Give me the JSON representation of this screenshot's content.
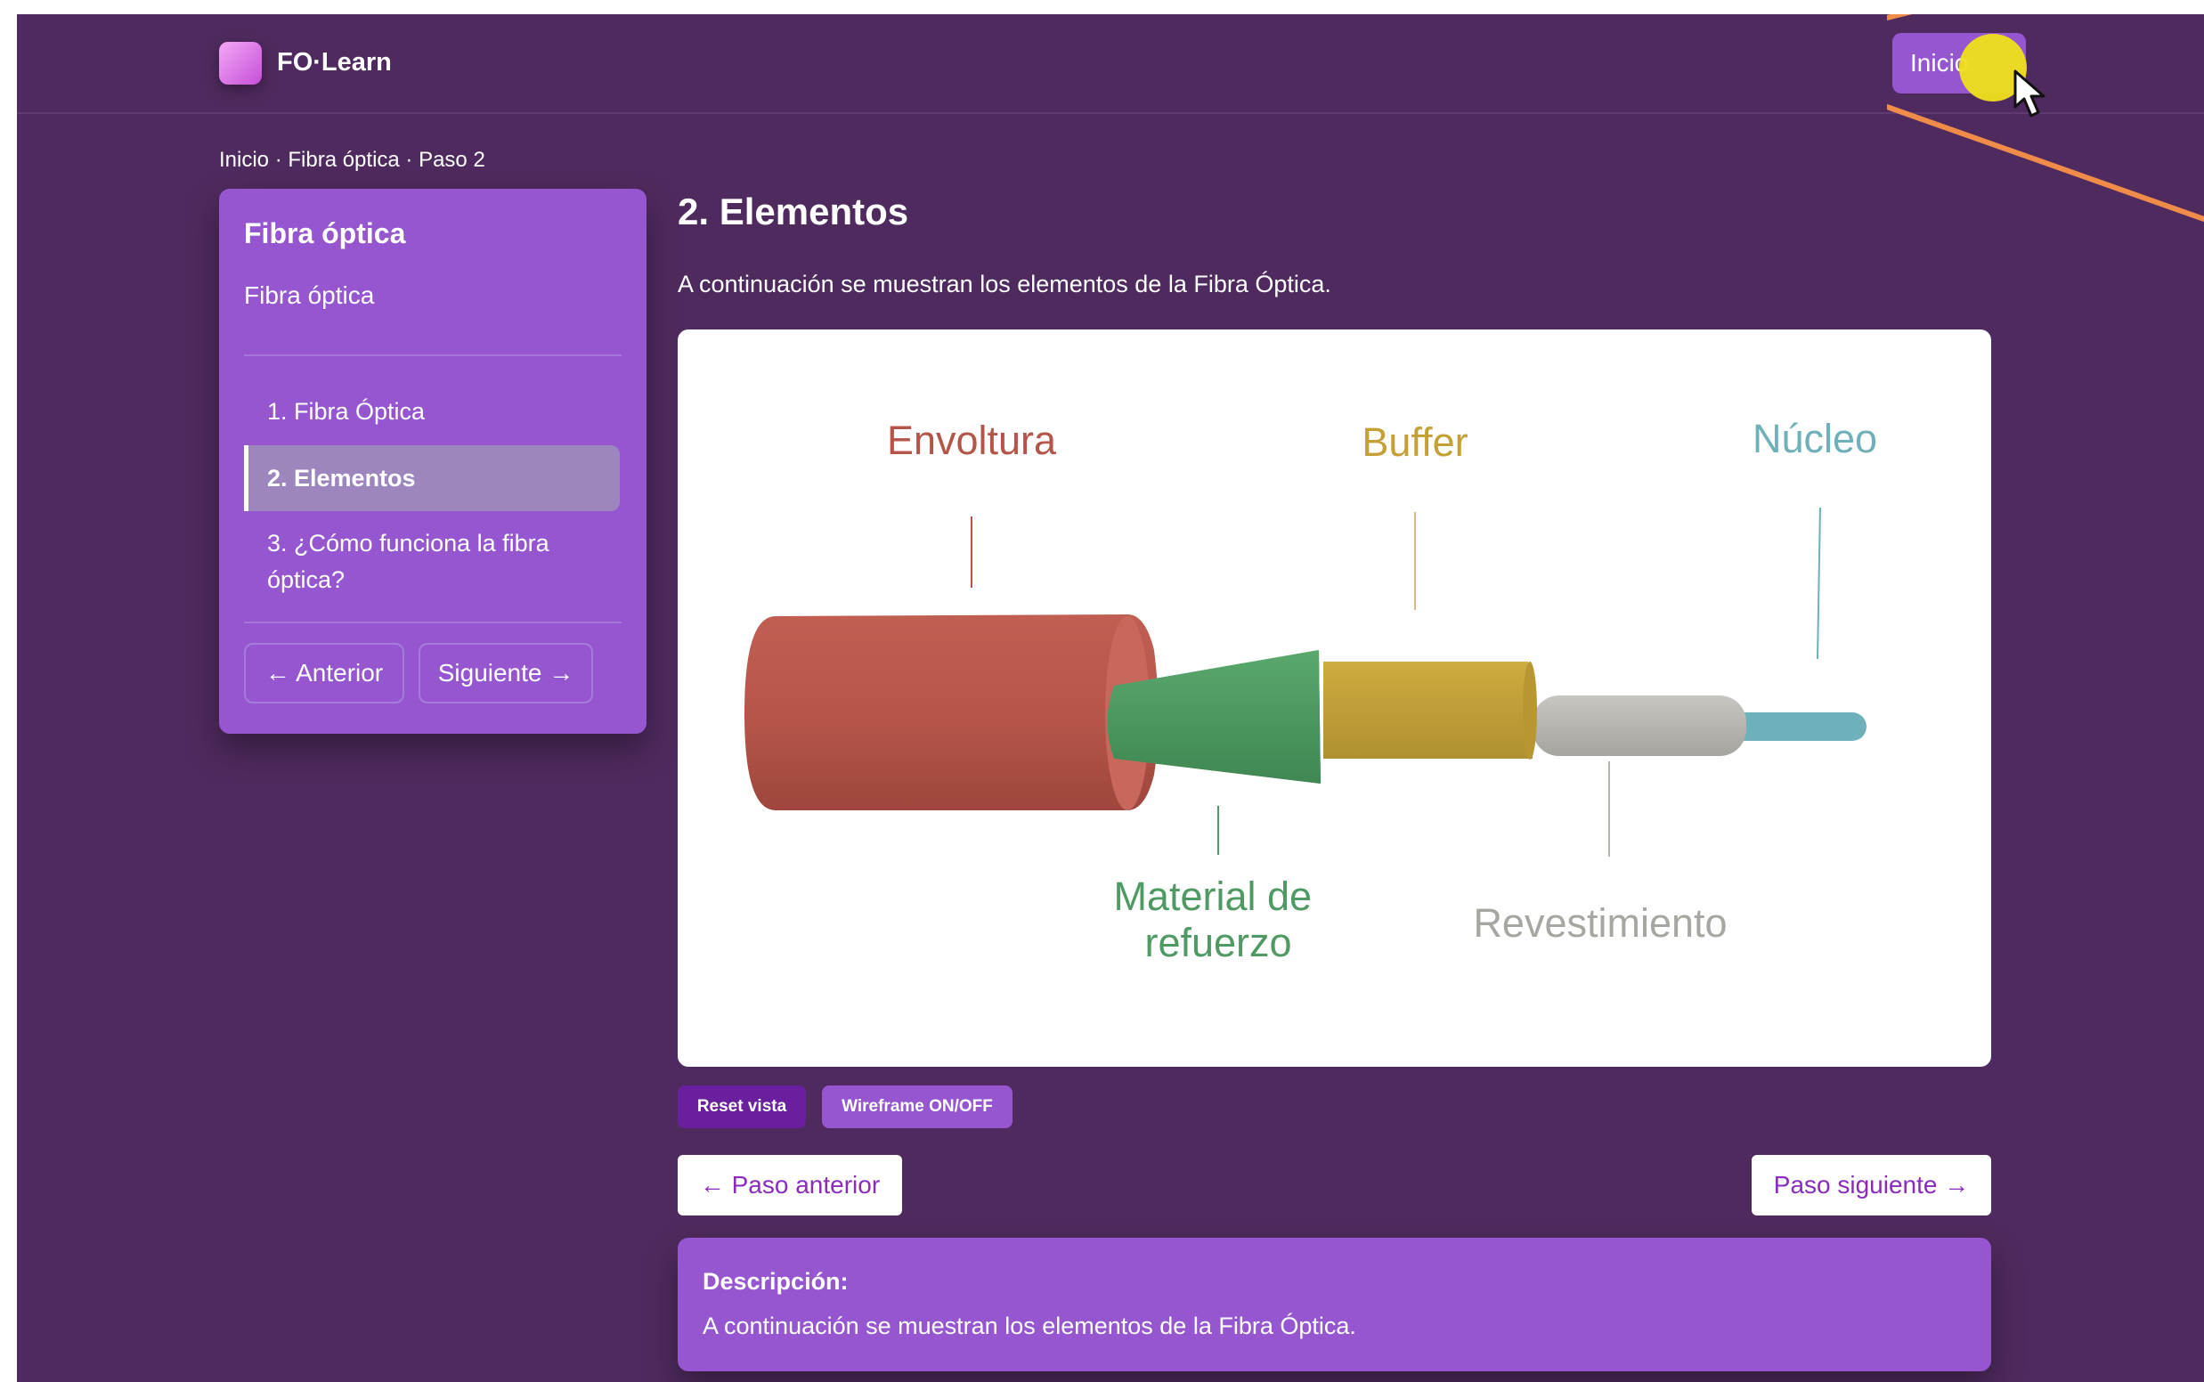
{
  "app": {
    "logo_text": "FO·Learn",
    "home_button": "Inicio"
  },
  "breadcrumb": "Inicio · Fibra óptica · Paso 2",
  "sidebar": {
    "title": "Fibra óptica",
    "subtitle": "Fibra óptica",
    "items": [
      {
        "label": "1. Fibra Óptica"
      },
      {
        "label": "2. Elementos",
        "active": true
      },
      {
        "label": "3. ¿Cómo funciona la fibra óptica?"
      }
    ],
    "prev_button": "← Anterior",
    "next_button": "Siguiente →"
  },
  "main": {
    "title": "2. Elementos",
    "intro": "A continuación se muestran los elementos de la Fibra Óptica.",
    "viewer_labels": {
      "jacket": "Envoltura",
      "buffer": "Buffer",
      "core": "Núcleo",
      "strength": "Material de refuerzo",
      "cladding": "Revestimiento"
    },
    "reset_button": "Reset vista",
    "wireframe_button": "Wireframe ON/OFF",
    "prev_step": "← Paso anterior",
    "next_step": "Paso siguiente →"
  },
  "description": {
    "label": "Descripción:",
    "text": "A continuación se muestran los elementos de la Fibra Óptica."
  },
  "colors": {
    "page_bg": "#4f2a5e",
    "panel": "#9556d0",
    "jacket": "#b5554a",
    "strength": "#4f9a63",
    "buffer": "#c4a035",
    "cladding": "#b7b5b0",
    "core": "#6fb1bb",
    "cursor_highlight": "#f0e01a"
  }
}
